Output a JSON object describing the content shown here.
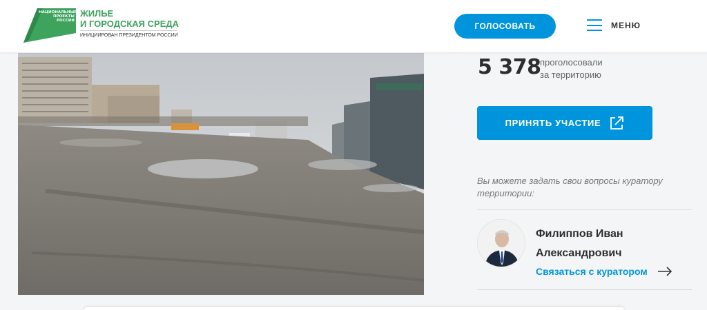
{
  "header": {
    "logo": {
      "mark_lines": [
        "НАЦИОНАЛЬНЫЕ",
        "ПРОЕКТЫ",
        "РОССИИ"
      ],
      "title_lines": [
        "ЖИЛЬЕ",
        "И ГОРОДСКАЯ СРЕДА"
      ],
      "subtitle": "ИНИЦИИРОВАН ПРЕЗИДЕНТОМ РОССИИ"
    },
    "vote_button": "ГОЛОСОВАТЬ",
    "menu_label": "МЕНЮ"
  },
  "stats": {
    "votes": "5 378",
    "caption_lines": [
      "проголосовали",
      "за территорию"
    ]
  },
  "join_button": "ПРИНЯТЬ УЧАСТИЕ",
  "question_text": "Вы можете задать свои вопросы куратору территории:",
  "curator": {
    "name_lines": [
      "Филиппов Иван",
      "Александрович"
    ],
    "contact_label": "Связаться с куратором"
  },
  "colors": {
    "accent": "#0094dd",
    "logo_green": "#3da35d",
    "text_dark": "#2e2e2e"
  },
  "icons": {
    "menu": "hamburger-menu-icon",
    "external": "external-link-icon",
    "arrow": "arrow-right-icon"
  }
}
